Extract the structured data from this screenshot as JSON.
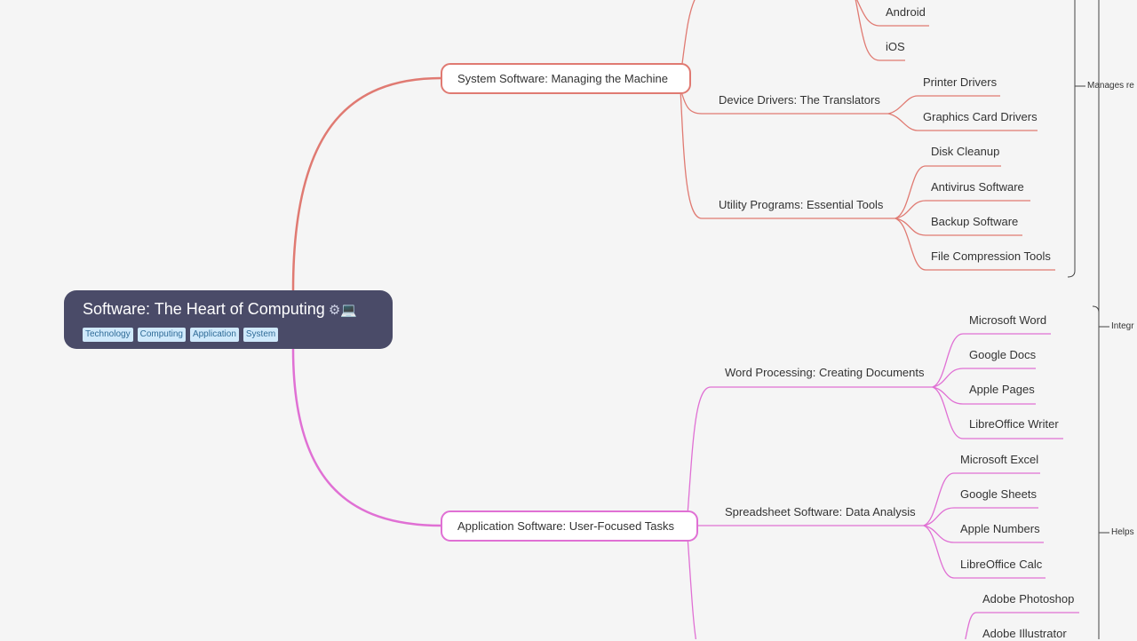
{
  "root": {
    "title": "Software: The Heart of Computing",
    "icon": "⚙💻",
    "tags": [
      "Technology",
      "Computing",
      "Application",
      "System"
    ]
  },
  "system": {
    "label": "System Software: Managing the Machine",
    "color": "#e07a72",
    "os_children": [
      "Android",
      "iOS"
    ],
    "drivers": {
      "label": "Device Drivers: The Translators",
      "children": [
        "Printer Drivers",
        "Graphics Card Drivers"
      ]
    },
    "utilities": {
      "label": "Utility Programs: Essential Tools",
      "children": [
        "Disk Cleanup",
        "Antivirus Software",
        "Backup Software",
        "File Compression Tools"
      ]
    }
  },
  "application": {
    "label": "Application Software: User-Focused Tasks",
    "color": "#e070d4",
    "word": {
      "label": "Word Processing: Creating Documents",
      "children": [
        "Microsoft Word",
        "Google Docs",
        "Apple Pages",
        "LibreOffice Writer"
      ]
    },
    "spreadsheet": {
      "label": "Spreadsheet Software: Data Analysis",
      "children": [
        "Microsoft Excel",
        "Google Sheets",
        "Apple Numbers",
        "LibreOffice Calc"
      ]
    },
    "graphics_children": [
      "Adobe Photoshop",
      "Adobe Illustrator"
    ]
  },
  "relations": [
    "Manages re",
    "Integr",
    "Helps"
  ]
}
